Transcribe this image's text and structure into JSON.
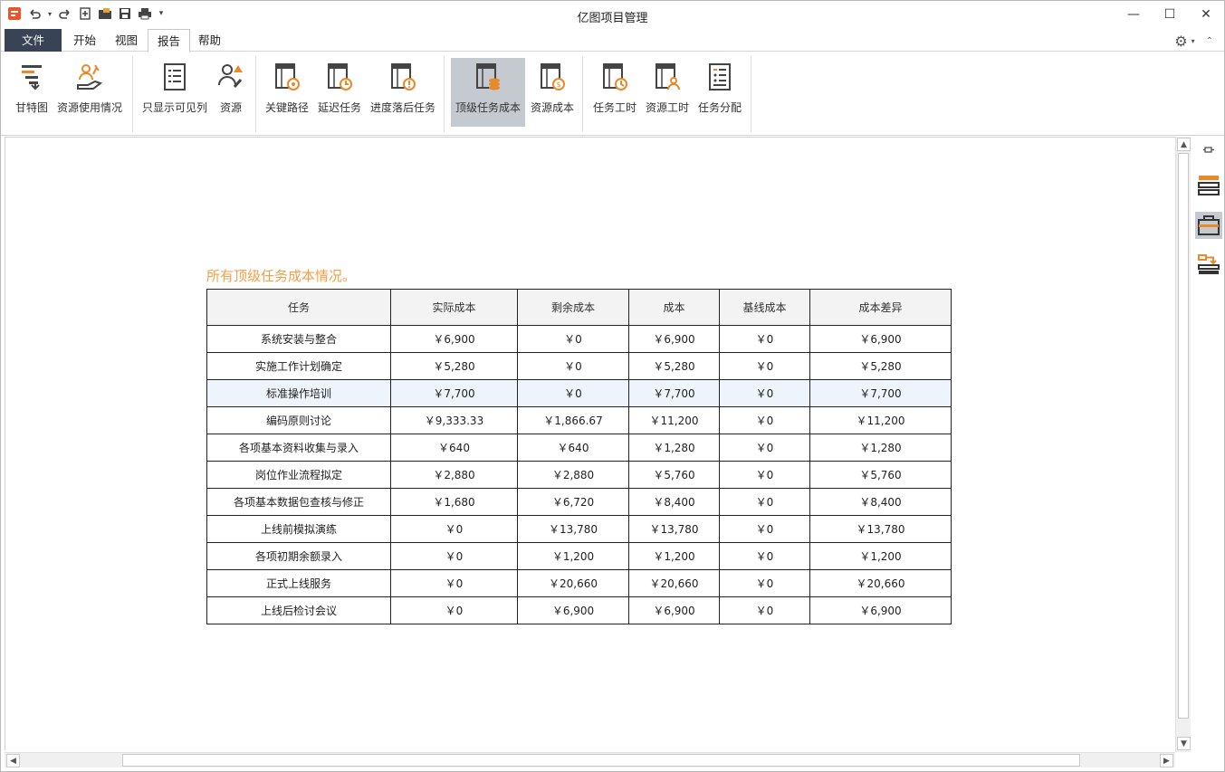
{
  "app": {
    "title": "亿图项目管理"
  },
  "menu": {
    "tabs": [
      {
        "label": "文件"
      },
      {
        "label": "开始"
      },
      {
        "label": "视图"
      },
      {
        "label": "报告"
      },
      {
        "label": "帮助"
      }
    ],
    "active_tab": "报告"
  },
  "ribbon": {
    "buttons": [
      {
        "label": "甘特图",
        "icon": "gantt-chart-icon"
      },
      {
        "label": "资源使用情况",
        "icon": "resource-usage-icon"
      },
      {
        "label": "只显示可见列",
        "icon": "visible-columns-icon"
      },
      {
        "label": "资源",
        "icon": "resource-icon"
      },
      {
        "label": "关键路径",
        "icon": "critical-path-icon"
      },
      {
        "label": "延迟任务",
        "icon": "delayed-task-icon"
      },
      {
        "label": "进度落后任务",
        "icon": "behind-schedule-icon"
      },
      {
        "label": "顶级任务成本",
        "icon": "top-task-cost-icon"
      },
      {
        "label": "资源成本",
        "icon": "resource-cost-icon"
      },
      {
        "label": "任务工时",
        "icon": "task-hours-icon"
      },
      {
        "label": "资源工时",
        "icon": "resource-hours-icon"
      },
      {
        "label": "任务分配",
        "icon": "task-assignment-icon"
      }
    ],
    "selected": "顶级任务成本"
  },
  "report": {
    "title": "所有顶级任务成本情况。",
    "columns": [
      "任务",
      "实际成本",
      "剩余成本",
      "成本",
      "基线成本",
      "成本差异"
    ],
    "rows": [
      [
        "系统安装与整合",
        "￥6,900",
        "￥0",
        "￥6,900",
        "￥0",
        "￥6,900"
      ],
      [
        "实施工作计划确定",
        "￥5,280",
        "￥0",
        "￥5,280",
        "￥0",
        "￥5,280"
      ],
      [
        "标准操作培训",
        "￥7,700",
        "￥0",
        "￥7,700",
        "￥0",
        "￥7,700"
      ],
      [
        "编码原则讨论",
        "￥9,333.33",
        "￥1,866.67",
        "￥11,200",
        "￥0",
        "￥11,200"
      ],
      [
        "各项基本资料收集与录入",
        "￥640",
        "￥640",
        "￥1,280",
        "￥0",
        "￥1,280"
      ],
      [
        "岗位作业流程拟定",
        "￥2,880",
        "￥2,880",
        "￥5,760",
        "￥0",
        "￥5,760"
      ],
      [
        "各项基本数据包查核与修正",
        "￥1,680",
        "￥6,720",
        "￥8,400",
        "￥0",
        "￥8,400"
      ],
      [
        "上线前模拟演练",
        "￥0",
        "￥13,780",
        "￥13,780",
        "￥0",
        "￥13,780"
      ],
      [
        "各项初期余额录入",
        "￥0",
        "￥1,200",
        "￥1,200",
        "￥0",
        "￥1,200"
      ],
      [
        "正式上线服务",
        "￥0",
        "￥20,660",
        "￥20,660",
        "￥0",
        "￥20,660"
      ],
      [
        "上线后检讨会议",
        "￥0",
        "￥6,900",
        "￥6,900",
        "￥0",
        "￥6,900"
      ]
    ],
    "highlighted_row": 2
  },
  "colors": {
    "accent_orange": "#f0a04b",
    "file_tab": "#394356",
    "selected_button": "#c5c9d0",
    "row_highlight": "#eef4fc"
  }
}
